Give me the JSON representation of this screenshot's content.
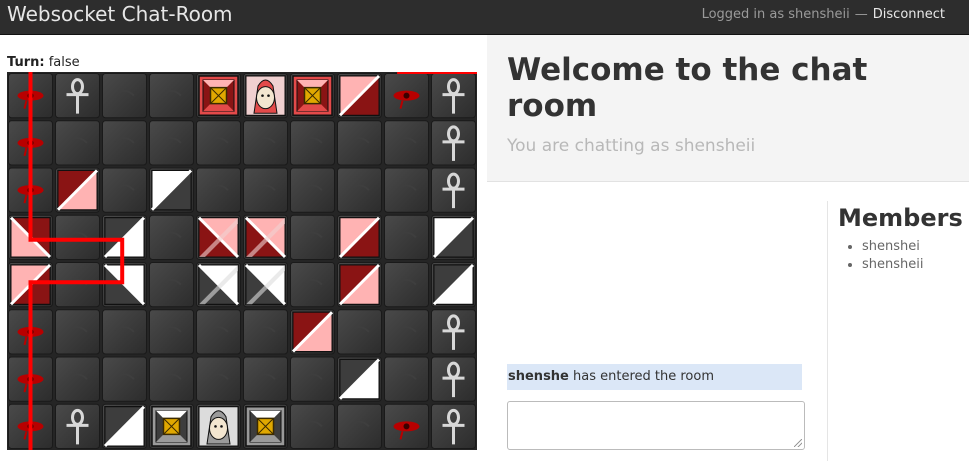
{
  "app": {
    "title": "Websocket Chat-Room"
  },
  "topbar": {
    "logged_in_text": "Logged in as shensheii",
    "separator": "—",
    "disconnect_label": "Disconnect"
  },
  "game": {
    "turn_label": "Turn:",
    "turn_value": "false",
    "cols": 10,
    "rows": 8,
    "glyph_rows": [
      [
        "eye",
        "ankh",
        "",
        "",
        "",
        "",
        "",
        "",
        "eye",
        "ankh"
      ],
      [
        "eye",
        "",
        "",
        "",
        "",
        "",
        "",
        "",
        "",
        "ankh"
      ],
      [
        "eye",
        "",
        "",
        "",
        "",
        "",
        "",
        "",
        "",
        "ankh"
      ],
      [
        "eye",
        "",
        "",
        "",
        "",
        "",
        "",
        "",
        "",
        "ankh"
      ],
      [
        "eye",
        "",
        "",
        "",
        "",
        "",
        "",
        "",
        "",
        "ankh"
      ],
      [
        "eye",
        "",
        "",
        "",
        "",
        "",
        "",
        "",
        "",
        "ankh"
      ],
      [
        "eye",
        "",
        "",
        "",
        "",
        "",
        "",
        "",
        "",
        "ankh"
      ],
      [
        "eye",
        "ankh",
        "",
        "",
        "",
        "",
        "",
        "",
        "eye",
        "ankh"
      ]
    ],
    "pieces": [
      {
        "row": 0,
        "col": 4,
        "kind": "obelisk",
        "color": "red"
      },
      {
        "row": 0,
        "col": 5,
        "kind": "pharaoh",
        "color": "red"
      },
      {
        "row": 0,
        "col": 6,
        "kind": "obelisk",
        "color": "red"
      },
      {
        "row": 0,
        "col": 7,
        "kind": "pyramid",
        "color": "red",
        "dir": "ne"
      },
      {
        "row": 2,
        "col": 1,
        "kind": "pyramid",
        "color": "red",
        "dir": "sw"
      },
      {
        "row": 2,
        "col": 3,
        "kind": "pyramid",
        "color": "silver",
        "dir": "ne"
      },
      {
        "row": 3,
        "col": 0,
        "kind": "pyramid",
        "color": "red",
        "dir": "se"
      },
      {
        "row": 3,
        "col": 2,
        "kind": "pyramid",
        "color": "silver",
        "dir": "sw"
      },
      {
        "row": 3,
        "col": 4,
        "kind": "djed",
        "color": "red"
      },
      {
        "row": 3,
        "col": 5,
        "kind": "djed",
        "color": "red"
      },
      {
        "row": 3,
        "col": 7,
        "kind": "pyramid",
        "color": "red",
        "dir": "ne"
      },
      {
        "row": 3,
        "col": 9,
        "kind": "pyramid",
        "color": "silver",
        "dir": "ne"
      },
      {
        "row": 4,
        "col": 0,
        "kind": "pyramid",
        "color": "red",
        "dir": "ne"
      },
      {
        "row": 4,
        "col": 2,
        "kind": "pyramid",
        "color": "silver",
        "dir": "nw"
      },
      {
        "row": 4,
        "col": 4,
        "kind": "djed",
        "color": "silver"
      },
      {
        "row": 4,
        "col": 5,
        "kind": "djed",
        "color": "silver"
      },
      {
        "row": 4,
        "col": 7,
        "kind": "pyramid",
        "color": "red",
        "dir": "sw"
      },
      {
        "row": 4,
        "col": 9,
        "kind": "pyramid",
        "color": "silver",
        "dir": "sw"
      },
      {
        "row": 5,
        "col": 6,
        "kind": "pyramid",
        "color": "red",
        "dir": "sw"
      },
      {
        "row": 6,
        "col": 7,
        "kind": "pyramid",
        "color": "silver",
        "dir": "sw"
      },
      {
        "row": 7,
        "col": 2,
        "kind": "pyramid",
        "color": "silver",
        "dir": "sw"
      },
      {
        "row": 7,
        "col": 3,
        "kind": "obelisk",
        "color": "silver"
      },
      {
        "row": 7,
        "col": 4,
        "kind": "pharaoh",
        "color": "silver"
      },
      {
        "row": 7,
        "col": 5,
        "kind": "obelisk",
        "color": "silver"
      }
    ],
    "laser": {
      "color": "#ff0000",
      "paths": [
        [
          [
            0.5,
            0
          ],
          [
            0.5,
            3.55
          ],
          [
            2.45,
            3.55
          ],
          [
            2.45,
            4.45
          ],
          [
            0.5,
            4.45
          ],
          [
            0.5,
            8
          ]
        ],
        [
          [
            8.3,
            0
          ],
          [
            10,
            0
          ]
        ]
      ]
    }
  },
  "chat": {
    "welcome_title": "Welcome to the chat room",
    "subtitle": "You are chatting as shensheii",
    "messages": [
      {
        "user": "shenshe",
        "text": "has entered the room"
      }
    ],
    "input_value": ""
  },
  "members": {
    "heading": "Members",
    "list": [
      "shenshei",
      "shensheii"
    ]
  }
}
